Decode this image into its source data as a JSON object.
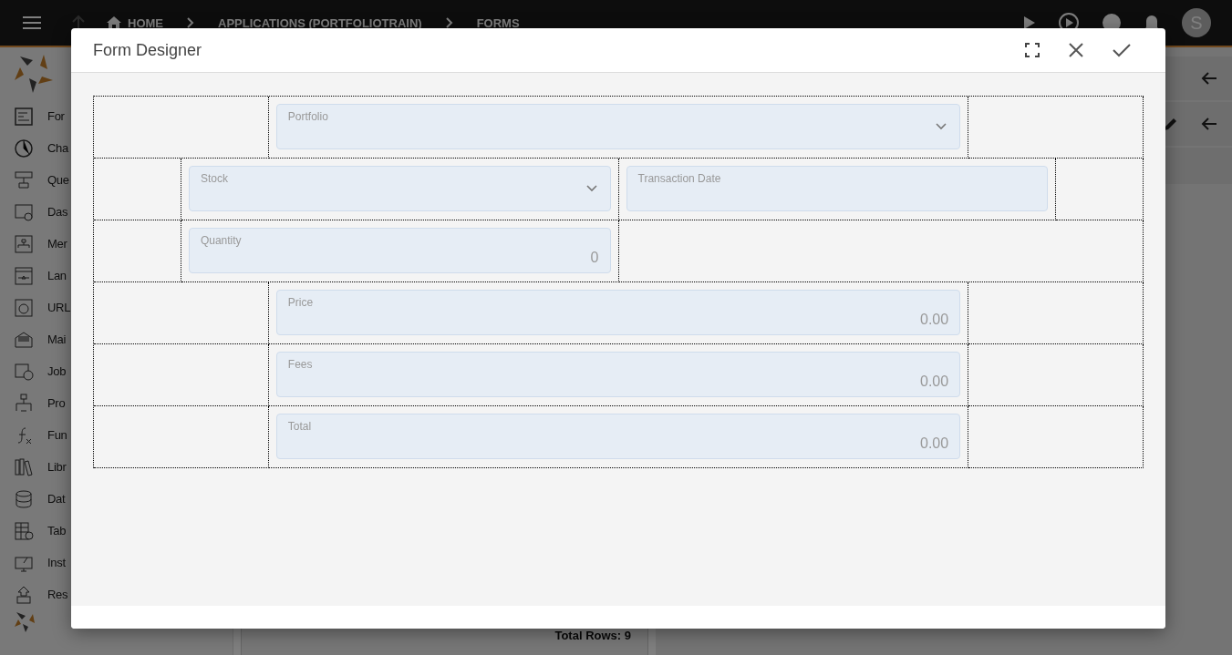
{
  "top_bar": {
    "breadcrumbs": [
      "HOME",
      "APPLICATIONS (PORTFOLIOTRAIN)",
      "FORMS"
    ],
    "avatar": "S"
  },
  "sidebar": {
    "items": [
      {
        "label": "For"
      },
      {
        "label": "Cha"
      },
      {
        "label": "Que"
      },
      {
        "label": "Das"
      },
      {
        "label": "Mer"
      },
      {
        "label": "Lan"
      },
      {
        "label": "URL"
      },
      {
        "label": "Mai"
      },
      {
        "label": "Job"
      },
      {
        "label": "Pro"
      },
      {
        "label": "Fun"
      },
      {
        "label": "Libr"
      },
      {
        "label": "Dat"
      },
      {
        "label": "Tab"
      },
      {
        "label": "Inst"
      },
      {
        "label": "Res"
      }
    ]
  },
  "list_panel": {
    "footer": "Total Rows: 9"
  },
  "dialog": {
    "title": "Form Designer",
    "rows": [
      {
        "cells": [
          {},
          {
            "field": {
              "kind": "select",
              "label": "Portfolio"
            }
          },
          {}
        ]
      },
      {
        "cells": [
          {},
          {
            "field": {
              "kind": "select",
              "label": "Stock"
            }
          },
          {
            "field": {
              "kind": "text",
              "label": "Transaction Date"
            }
          },
          {}
        ]
      },
      {
        "cells": [
          {},
          {
            "field": {
              "kind": "text",
              "label": "Quantity",
              "value": "0"
            }
          },
          {}
        ]
      },
      {
        "cells": [
          {},
          {
            "field": {
              "kind": "text",
              "label": "Price",
              "value": "0.00"
            }
          },
          {}
        ]
      },
      {
        "cells": [
          {},
          {
            "field": {
              "kind": "text",
              "label": "Fees",
              "value": "0.00"
            }
          },
          {}
        ]
      },
      {
        "cells": [
          {},
          {
            "field": {
              "kind": "text",
              "label": "Total",
              "value": "0.00"
            }
          },
          {}
        ]
      }
    ]
  }
}
